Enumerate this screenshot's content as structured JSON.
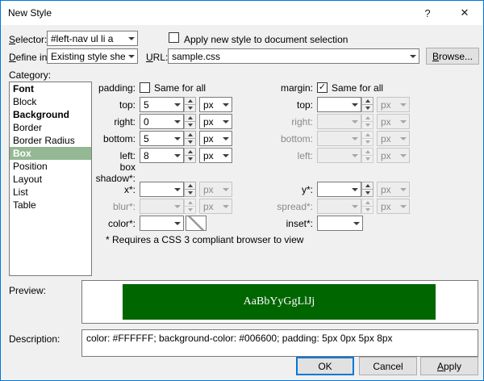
{
  "window": {
    "title": "New Style",
    "help": "?",
    "close": "✕"
  },
  "header": {
    "selector_label": "Selector:",
    "selector_value": "#left-nav ul li a",
    "apply_label": "Apply new style to document selection",
    "apply_checked": false,
    "define_label": "Define in:",
    "define_value": "Existing style sheet",
    "url_label": "URL:",
    "url_value": "sample.css",
    "browse_label": "Browse..."
  },
  "category": {
    "label": "Category:",
    "selected": "Box",
    "items": [
      "Font",
      "Block",
      "Background",
      "Border",
      "Border Radius",
      "Box",
      "Position",
      "Layout",
      "List",
      "Table"
    ]
  },
  "box": {
    "padding_label": "padding:",
    "padding_same_label": "Same for all",
    "padding_same_checked": false,
    "padding_check_glyph": "",
    "margin_label": "margin:",
    "margin_same_label": "Same for all",
    "margin_same_checked": true,
    "margin_check_glyph": "✓",
    "padding_rows": [
      {
        "label": "top:",
        "value": "5",
        "unit": "px"
      },
      {
        "label": "right:",
        "value": "0",
        "unit": "px"
      },
      {
        "label": "bottom:",
        "value": "5",
        "unit": "px"
      },
      {
        "label": "left:",
        "value": "8",
        "unit": "px"
      }
    ],
    "margin_rows": [
      {
        "label": "top:",
        "value": "",
        "unit": "px",
        "enabled": true
      },
      {
        "label": "right:",
        "value": "",
        "unit": "px",
        "enabled": false
      },
      {
        "label": "bottom:",
        "value": "",
        "unit": "px",
        "enabled": false
      },
      {
        "label": "left:",
        "value": "",
        "unit": "px",
        "enabled": false
      }
    ],
    "shadow_label": "box shadow*:",
    "shadow_left": [
      {
        "label": "x*:",
        "value": "",
        "unit": "px"
      },
      {
        "label": "blur*:",
        "value": "",
        "unit": "px"
      },
      {
        "label": "color*:",
        "value": ""
      }
    ],
    "shadow_right": [
      {
        "label": "y*:",
        "value": "",
        "unit": "px"
      },
      {
        "label": "spread*:",
        "value": "",
        "unit": "px"
      },
      {
        "label": "inset*:",
        "value": ""
      }
    ],
    "note": "* Requires a CSS 3 compliant browser to view"
  },
  "preview": {
    "label": "Preview:",
    "text": "AaBbYyGgLlJj",
    "bg": "#006600",
    "fg": "#FFFFFF"
  },
  "description": {
    "label": "Description:",
    "text": "color: #FFFFFF; background-color: #006600; padding: 5px 0px 5px 8px"
  },
  "buttons": {
    "ok": "OK",
    "cancel": "Cancel",
    "apply": "Apply"
  }
}
